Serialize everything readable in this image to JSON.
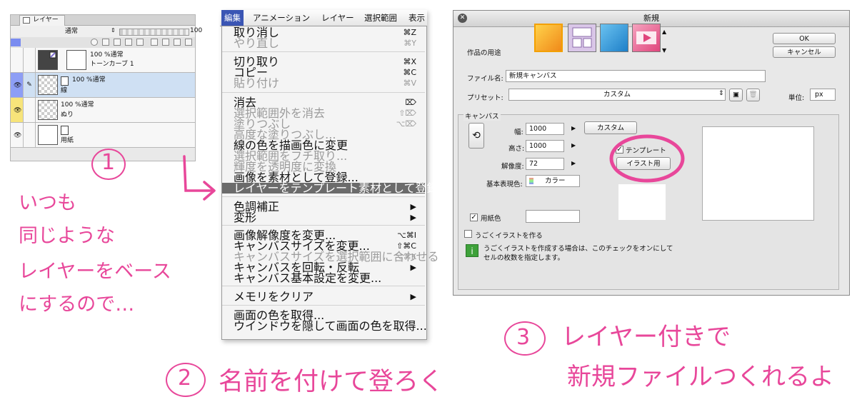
{
  "layer_panel": {
    "tab_label": "レイヤー",
    "blend_mode": "通常",
    "opacity": "100",
    "layers": [
      {
        "mode": "100 %通常",
        "name": "トーンカーブ 1"
      },
      {
        "mode": "100 %通常",
        "name": "線"
      },
      {
        "mode": "100 %通常",
        "name": "ぬり"
      },
      {
        "mode": "",
        "name": "用紙"
      }
    ]
  },
  "menubar": {
    "items": [
      "編集",
      "アニメーション",
      "レイヤー",
      "選択範囲",
      "表示"
    ]
  },
  "menu": {
    "items": [
      {
        "label": "取り消し",
        "shortcut": "⌘Z",
        "disabled": false
      },
      {
        "label": "やり直し",
        "shortcut": "⌘Y",
        "disabled": true
      },
      {
        "label": "切り取り",
        "shortcut": "⌘X",
        "disabled": false
      },
      {
        "label": "コピー",
        "shortcut": "⌘C",
        "disabled": false
      },
      {
        "label": "貼り付け",
        "shortcut": "⌘V",
        "disabled": true
      },
      {
        "label": "消去",
        "shortcut": "⌦",
        "disabled": false
      },
      {
        "label": "選択範囲外を消去",
        "shortcut": "⇧⌦",
        "disabled": true
      },
      {
        "label": "塗りつぶし",
        "shortcut": "⌥⌦",
        "disabled": true
      },
      {
        "label": "高度な塗りつぶし...",
        "shortcut": "",
        "disabled": true
      },
      {
        "label": "線の色を描画色に変更",
        "shortcut": "",
        "disabled": false
      },
      {
        "label": "選択範囲をフチ取り...",
        "shortcut": "",
        "disabled": true
      },
      {
        "label": "輝度を透明度に変換",
        "shortcut": "",
        "disabled": true
      },
      {
        "label": "画像を素材として登録...",
        "shortcut": "",
        "disabled": false
      },
      {
        "label": "レイヤーをテンプレート素材として登録...",
        "shortcut": "",
        "disabled": false,
        "highlighted": true
      },
      {
        "label": "色調補正",
        "shortcut": "▶",
        "disabled": false
      },
      {
        "label": "変形",
        "shortcut": "▶",
        "disabled": false
      },
      {
        "label": "画像解像度を変更...",
        "shortcut": "⌥⌘I",
        "disabled": false
      },
      {
        "label": "キャンバスサイズを変更...",
        "shortcut": "⇧⌘C",
        "disabled": false
      },
      {
        "label": "キャンバスサイズを選択範囲に合わせる",
        "shortcut": "⌥⌘K",
        "disabled": true
      },
      {
        "label": "キャンバスを回転・反転",
        "shortcut": "▶",
        "disabled": false
      },
      {
        "label": "キャンバス基本設定を変更...",
        "shortcut": "",
        "disabled": false
      },
      {
        "label": "メモリをクリア",
        "shortcut": "▶",
        "disabled": false
      },
      {
        "label": "画面の色を取得...",
        "shortcut": "",
        "disabled": false
      },
      {
        "label": "ウインドウを隠して画面の色を取得...",
        "shortcut": "",
        "disabled": false
      }
    ]
  },
  "dialog": {
    "title": "新規",
    "ok": "OK",
    "cancel": "キャンセル",
    "use_label": "作品の用途",
    "filename_label": "ファイル名:",
    "filename_value": "新規キャンバス",
    "preset_label": "プリセット:",
    "preset_value": "カスタム",
    "unit_label": "単位:",
    "unit_value": "px",
    "canvas_section": "キャンバス",
    "width_label": "幅:",
    "width_value": "1000",
    "height_label": "高さ:",
    "height_value": "1000",
    "resolution_label": "解像度:",
    "resolution_value": "72",
    "color_label": "基本表現色:",
    "color_value": "カラー",
    "size_preset": "カスタム",
    "template_label": "テンプレート",
    "template_button": "イラスト用",
    "paper_color_label": "用紙色",
    "anim_label": "うごくイラストを作る",
    "info_line1": "うごくイラストを作成する場合は、このチェックをオンにして",
    "info_line2": "セルの枚数を指定します。",
    "info_icon": "i"
  },
  "notes": {
    "n1_number": "1",
    "n1_lines": [
      "いつも",
      "同じような",
      "レイヤーをベース",
      "にするので…"
    ],
    "n2_number": "2",
    "n2_text": "名前を付けて登ろく",
    "n3_number": "3",
    "n3_line1": "レイヤー付きで",
    "n3_line2": "新規ファイルつくれるよ"
  },
  "colors": {
    "accent_pink": "#e8479a",
    "menu_highlight": "#6b6b6b",
    "menubar_active": "#3a55b4"
  }
}
